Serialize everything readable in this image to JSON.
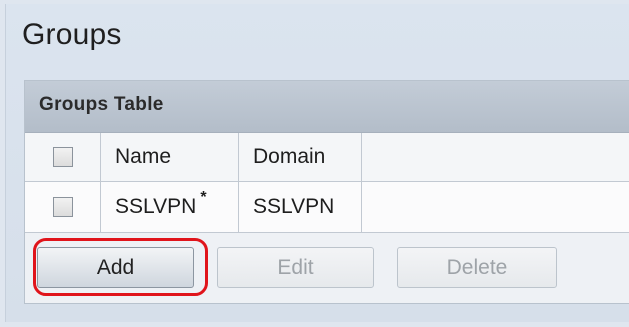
{
  "page": {
    "title": "Groups"
  },
  "table": {
    "title": "Groups Table",
    "columns": [
      "Name",
      "Domain"
    ],
    "rows": [
      {
        "name": "SSLVPN",
        "name_marker": "*",
        "domain": "SSLVPN"
      }
    ]
  },
  "buttons": {
    "add": "Add",
    "edit": "Edit",
    "delete": "Delete"
  },
  "colors": {
    "highlight": "#e0141b",
    "panel_header": "#b8c2ce"
  }
}
